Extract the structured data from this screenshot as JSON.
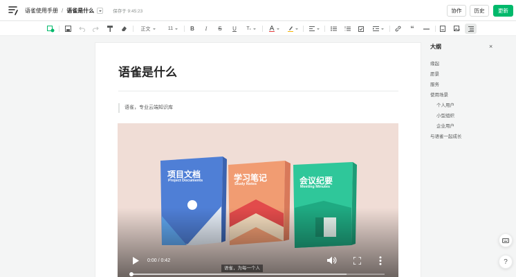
{
  "header": {
    "book_name": "语雀使用手册",
    "separator": "/",
    "doc_name": "语雀是什么",
    "save_status": "保存于 9:45:23",
    "collab_label": "协作",
    "history_label": "历史",
    "update_label": "更新"
  },
  "toolbar": {
    "style_label": "正文",
    "size_label": "11",
    "icons": [
      "insert-icon",
      "save-icon",
      "undo-icon",
      "redo-icon",
      "format-painter-icon",
      "eraser-icon",
      "paragraph-style",
      "font-size",
      "bold-icon",
      "italic-icon",
      "strikethrough-icon",
      "underline-icon",
      "more-format-icon",
      "font-color-icon",
      "highlight-icon",
      "align-icon",
      "bullet-list-icon",
      "ordered-list-icon",
      "task-list-icon",
      "indent-icon",
      "link-icon",
      "quote-icon",
      "divider-icon",
      "screenshot-icon",
      "image-icon",
      "outline-toggle-icon"
    ],
    "accent_insert": "#00b96b",
    "font_color": "#e63c3c",
    "highlight_color": "#f5b300"
  },
  "document": {
    "title": "语雀是什么",
    "quote": "语雀，专业云端知识库"
  },
  "video": {
    "books": [
      {
        "title": "项目文档",
        "subtitle": "Project Documents",
        "color": "#4f7fd6"
      },
      {
        "title": "学习笔记",
        "subtitle": "Study Notes",
        "color": "#f19c72"
      },
      {
        "title": "会议纪要",
        "subtitle": "Meeting Minutes",
        "color": "#2fc79a"
      }
    ],
    "time": "0:00 / 0:42",
    "caption": "语雀，为每一个人",
    "progress": 0,
    "buffered": 0.85
  },
  "outline": {
    "title": "大纲",
    "close": "×",
    "items": [
      {
        "label": "缘起",
        "level": 1
      },
      {
        "label": "愿景",
        "level": 1
      },
      {
        "label": "服务",
        "level": 1
      },
      {
        "label": "使用场景",
        "level": 1
      },
      {
        "label": "个人用户",
        "level": 2
      },
      {
        "label": "小型组织",
        "level": 2
      },
      {
        "label": "企业用户",
        "level": 2
      },
      {
        "label": "与语雀一起成长",
        "level": 1
      }
    ]
  },
  "floating": {
    "help_label": "?"
  }
}
